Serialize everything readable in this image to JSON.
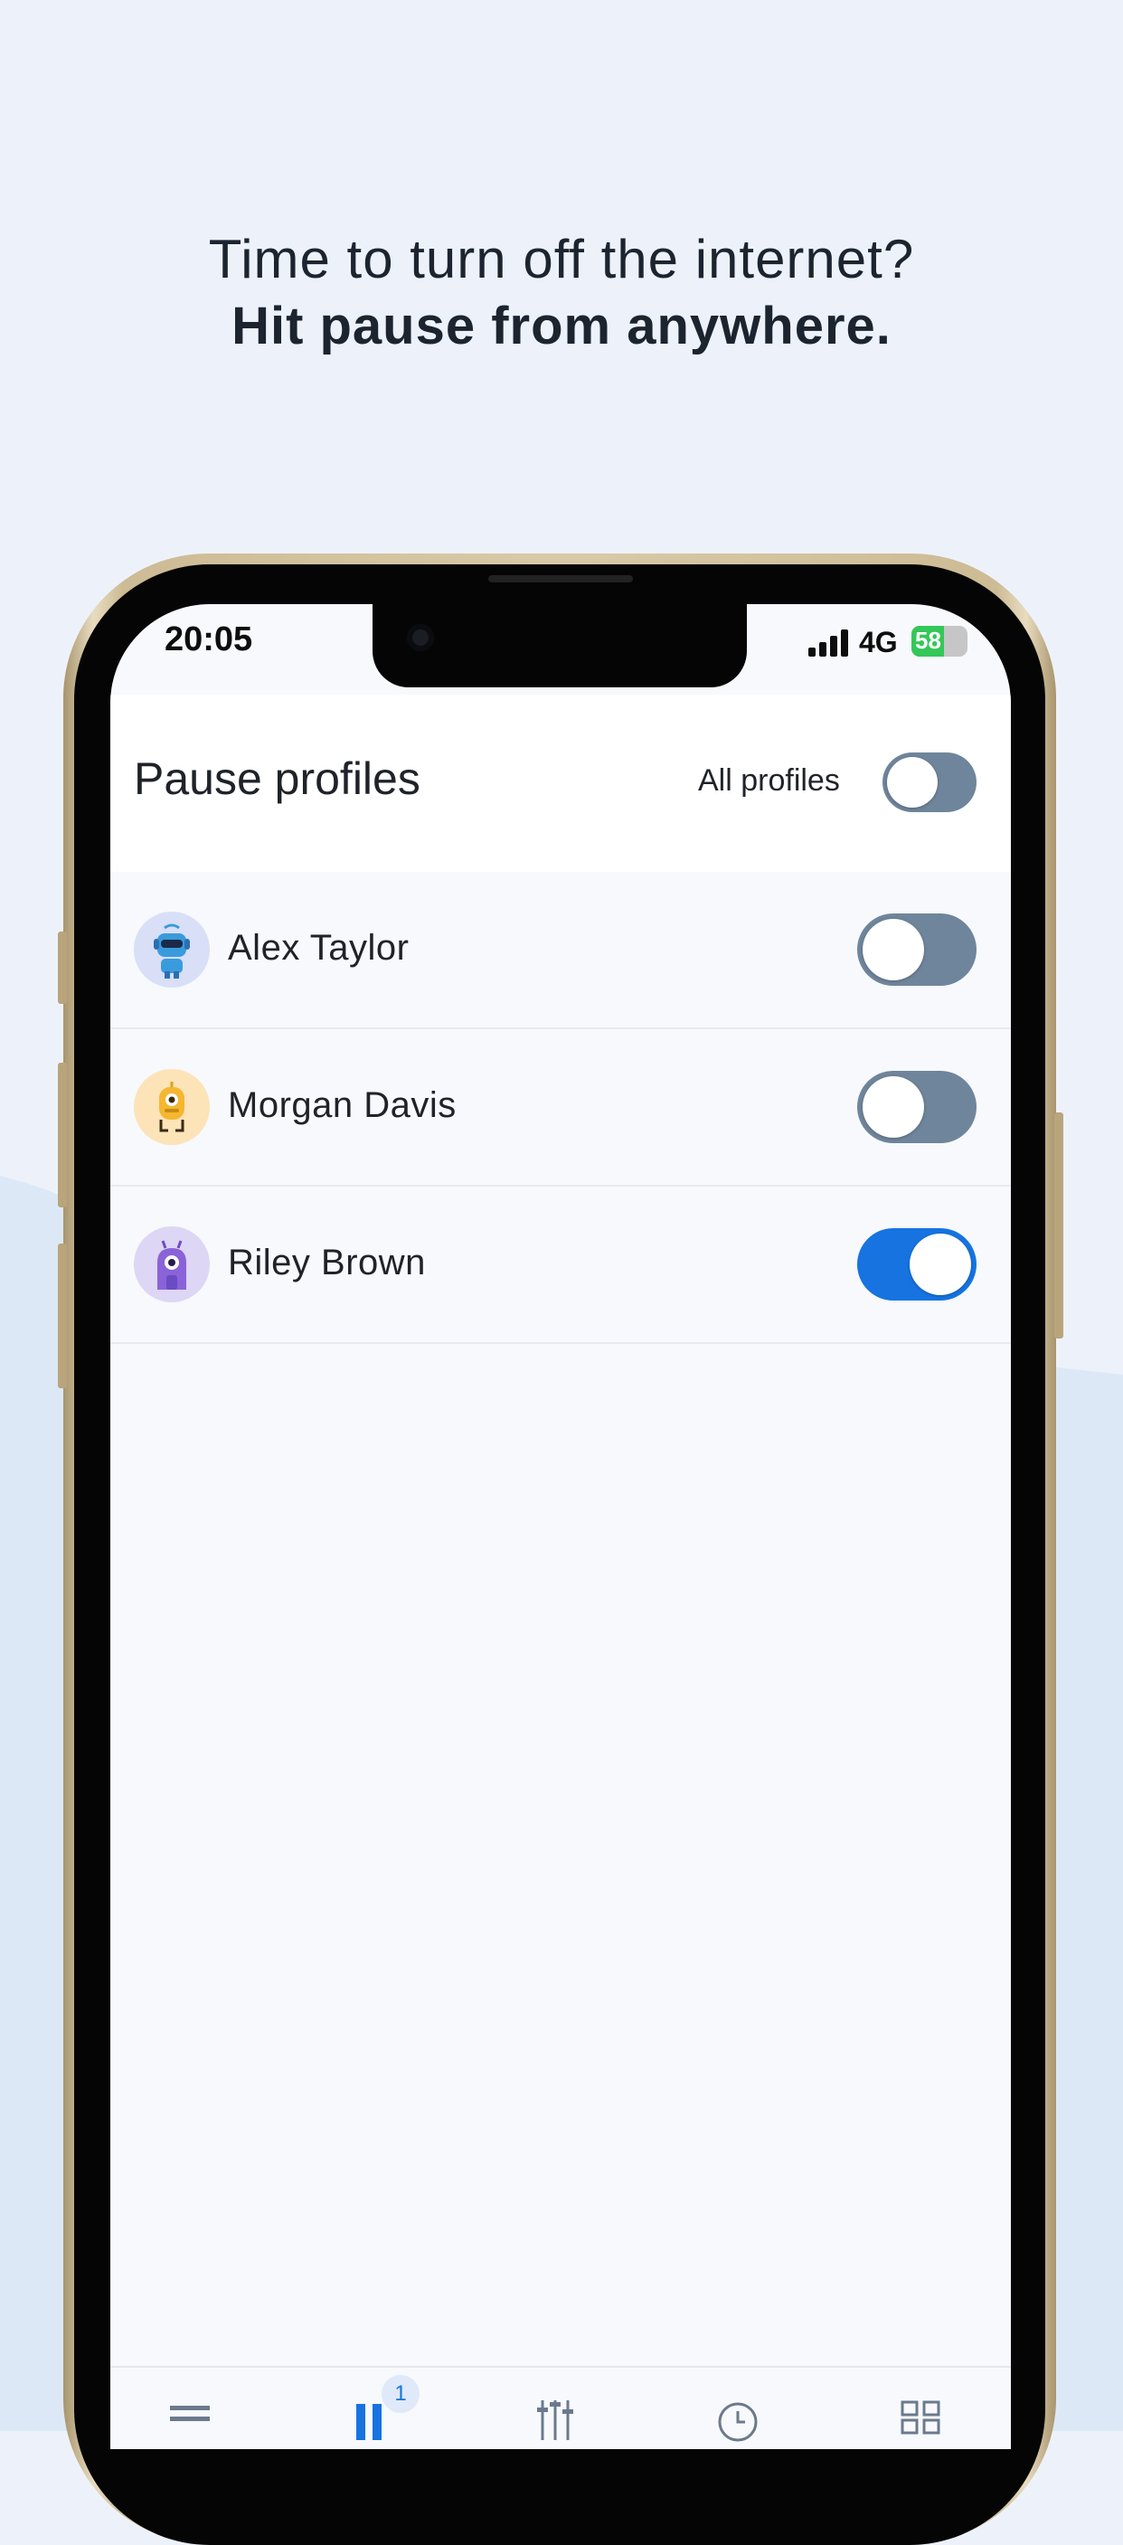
{
  "promo": {
    "line1": "Time to turn off the internet?",
    "line2": "Hit pause from anywhere."
  },
  "status_bar": {
    "time": "20:05",
    "network": "4G",
    "battery": "58",
    "battery_level": 0.58
  },
  "header": {
    "title": "Pause profiles",
    "all_profiles_label": "All profiles",
    "all_profiles_on": false
  },
  "profiles": [
    {
      "name": "Alex Taylor",
      "avatar": "blue-robot-avatar",
      "paused": false
    },
    {
      "name": "Morgan Davis",
      "avatar": "yellow-robot-avatar",
      "paused": false
    },
    {
      "name": "Riley Brown",
      "avatar": "purple-robot-avatar",
      "paused": true
    }
  ],
  "tabbar": {
    "items": [
      "home-icon",
      "pause-icon",
      "settings-sliders-icon",
      "clock-icon",
      "grid-icon"
    ],
    "active": "pause-icon",
    "badge": "1"
  },
  "colors": {
    "accent": "#1673e0",
    "toggle_off": "#6f859b",
    "background": "#edf2fa"
  }
}
